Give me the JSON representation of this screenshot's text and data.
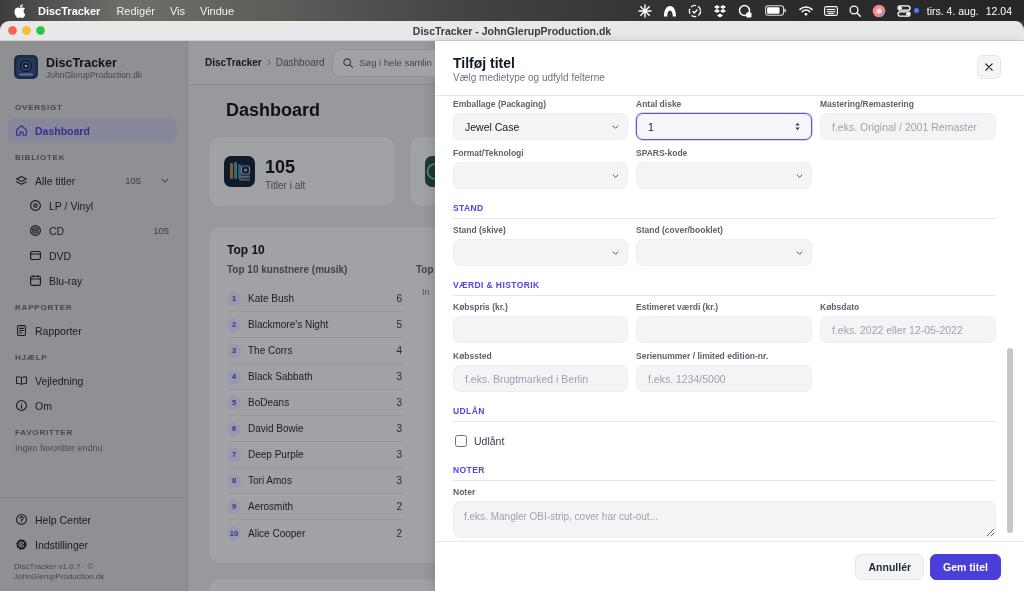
{
  "menubar": {
    "app_name": "DiscTracker",
    "menus": [
      "Redigér",
      "Vis",
      "Vindue"
    ],
    "date": "tirs. 4. aug.",
    "time": "12.04"
  },
  "window": {
    "title": "DiscTracker - JohnGlerupProduction.dk"
  },
  "sidebar": {
    "app_name": "DiscTracker",
    "app_subtitle": "JohnGlerupProduction.dk",
    "sections": [
      {
        "title": "OVERSIGT",
        "items": [
          {
            "label": "Dashboard",
            "selected": true
          }
        ]
      },
      {
        "title": "BIBLIOTEK",
        "items": [
          {
            "label": "Alle titler",
            "count": "105",
            "expanded": true,
            "selected": false,
            "children": [
              {
                "label": "LP / Vinyl",
                "selected": false
              },
              {
                "label": "CD",
                "count": "105",
                "selected": false
              },
              {
                "label": "DVD",
                "selected": false
              },
              {
                "label": "Blu-ray",
                "selected": false
              }
            ]
          }
        ]
      },
      {
        "title": "RAPPORTER",
        "items": [
          {
            "label": "Rapporter",
            "selected": false
          }
        ]
      },
      {
        "title": "HJÆLP",
        "items": [
          {
            "label": "Vejledning",
            "selected": false
          },
          {
            "label": "Om",
            "selected": false
          }
        ]
      },
      {
        "title": "FAVORITTER",
        "empty_text": "Ingen favoritter endnu"
      }
    ],
    "footer_items": [
      {
        "label": "Help Center",
        "selected": false
      },
      {
        "label": "Indstillinger",
        "selected": false
      }
    ],
    "footer_note": "DiscTracker v1.0.7 · © JohnGlerupProduction.dk"
  },
  "topbar": {
    "breadcrumb": [
      "DiscTracker",
      "Dashboard"
    ],
    "search": {
      "placeholder": "Søg i hele samlin"
    }
  },
  "dashboard": {
    "title": "Dashboard",
    "stats": [
      {
        "value": "105",
        "label": "Titler i alt"
      }
    ],
    "top10": {
      "title": "Top 10",
      "lists": [
        {
          "title": "Top 10 kunstnere (musik)",
          "rows": [
            {
              "rank": "1",
              "name": "Kate Bush",
              "count": "6"
            },
            {
              "rank": "2",
              "name": "Blackmore's Night",
              "count": "5"
            },
            {
              "rank": "3",
              "name": "The Corrs",
              "count": "4"
            },
            {
              "rank": "4",
              "name": "Black Sabbath",
              "count": "3"
            },
            {
              "rank": "5",
              "name": "BoDeans",
              "count": "3"
            },
            {
              "rank": "6",
              "name": "David Bowie",
              "count": "3"
            },
            {
              "rank": "7",
              "name": "Deep Purple",
              "count": "3"
            },
            {
              "rank": "8",
              "name": "Tori Amos",
              "count": "3"
            },
            {
              "rank": "9",
              "name": "Aerosmith",
              "count": "2"
            },
            {
              "rank": "10",
              "name": "Alice Cooper",
              "count": "2"
            }
          ]
        },
        {
          "title": "Top",
          "empty_text": "In"
        }
      ]
    }
  },
  "dialog": {
    "title": "Tilføj titel",
    "subtitle": "Vælg medietype og udfyld felterne",
    "sections": [
      {
        "rows": [
          [
            {
              "label": "Emballage (Packaging)",
              "kind": "select",
              "value": "Jewel Case",
              "focused": false
            },
            {
              "label": "Antal diske",
              "kind": "number",
              "value": "1",
              "focused": true
            },
            {
              "label": "Mastering/Remastering",
              "kind": "text",
              "placeholder": "f.eks. Original / 2001 Remaster",
              "focused": false
            }
          ],
          [
            {
              "label": "Format/Teknologi",
              "kind": "select",
              "focused": false
            },
            {
              "label": "SPARS-kode",
              "kind": "select",
              "focused": false
            }
          ]
        ]
      },
      {
        "title": "STAND",
        "rows": [
          [
            {
              "label": "Stand (skive)",
              "kind": "select",
              "focused": false
            },
            {
              "label": "Stand (cover/booklet)",
              "kind": "select",
              "focused": false
            }
          ]
        ]
      },
      {
        "title": "VÆRDI & HISTORIK",
        "rows": [
          [
            {
              "label": "Købspris (kr.)",
              "kind": "text",
              "focused": false
            },
            {
              "label": "Estimeret værdi (kr.)",
              "kind": "text",
              "focused": false
            },
            {
              "label": "Købsdato",
              "kind": "text",
              "placeholder": "f.eks. 2022 eller 12-05-2022",
              "focused": false
            }
          ],
          [
            {
              "label": "Købssted",
              "kind": "text",
              "placeholder": "f.eks. Brugtmarked i Berlin",
              "focused": false
            },
            {
              "label": "Serienummer / limited edition-nr.",
              "kind": "text",
              "placeholder": "f.eks. 1234/5000",
              "focused": false
            }
          ]
        ]
      },
      {
        "title": "UDLÅN",
        "rows": [
          [
            {
              "label": "Udlånt",
              "kind": "checkbox",
              "checked": false
            }
          ]
        ]
      },
      {
        "title": "NOTER",
        "rows": [
          [
            {
              "label": "Noter",
              "kind": "textarea",
              "placeholder": "f.eks. Mangler OBI-strip, cover har cut-out...",
              "focused": false
            }
          ]
        ]
      }
    ],
    "buttons": [
      {
        "label": "Annullér",
        "kind": "secondary"
      },
      {
        "label": "Gem titel",
        "kind": "primary"
      }
    ]
  }
}
